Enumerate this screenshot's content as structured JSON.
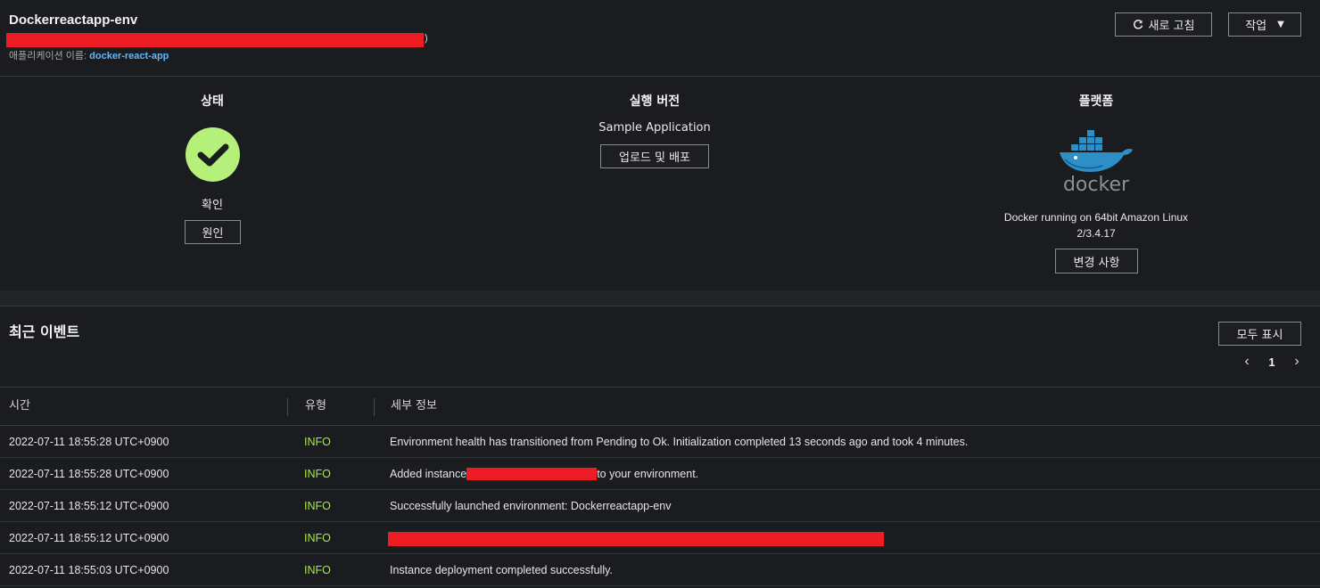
{
  "header": {
    "env_name": "Dockerreactapp-env",
    "paren": ")",
    "app_label": "애플리케이션 이름: ",
    "app_name": "docker-react-app",
    "refresh_label": "새로 고침",
    "actions_label": "작업"
  },
  "overview": {
    "status": {
      "title": "상태",
      "value": "확인",
      "cause_label": "원인"
    },
    "version": {
      "title": "실행 버전",
      "value": "Sample Application",
      "deploy_label": "업로드 및 배포"
    },
    "platform": {
      "title": "플랫폼",
      "logo_text": "docker",
      "description": "Docker running on 64bit Amazon Linux 2/3.4.17",
      "change_label": "변경 사항"
    }
  },
  "events": {
    "title": "최근 이벤트",
    "show_all_label": "모두 표시",
    "page": "1",
    "columns": [
      "시간",
      "유형",
      "세부 정보"
    ],
    "rows": [
      {
        "time": "2022-07-11 18:55:28 UTC+0900",
        "type": "INFO",
        "detail": "Environment health has transitioned from Pending to Ok. Initialization completed 13 seconds ago and took 4 minutes."
      },
      {
        "time": "2022-07-11 18:55:28 UTC+0900",
        "type": "INFO",
        "detail_pre": "Added instance",
        "detail_post": "to your environment."
      },
      {
        "time": "2022-07-11 18:55:12 UTC+0900",
        "type": "INFO",
        "detail": "Successfully launched environment: Dockerreactapp-env"
      },
      {
        "time": "2022-07-11 18:55:12 UTC+0900",
        "type": "INFO",
        "detail": ""
      },
      {
        "time": "2022-07-11 18:55:03 UTC+0900",
        "type": "INFO",
        "detail": "Instance deployment completed successfully."
      }
    ]
  },
  "colors": {
    "background": "#1b1c1f",
    "health_ok": "#b5f07a",
    "info": "#a8e84a",
    "link": "#5bb8ff",
    "redaction": "#ee1c25"
  }
}
